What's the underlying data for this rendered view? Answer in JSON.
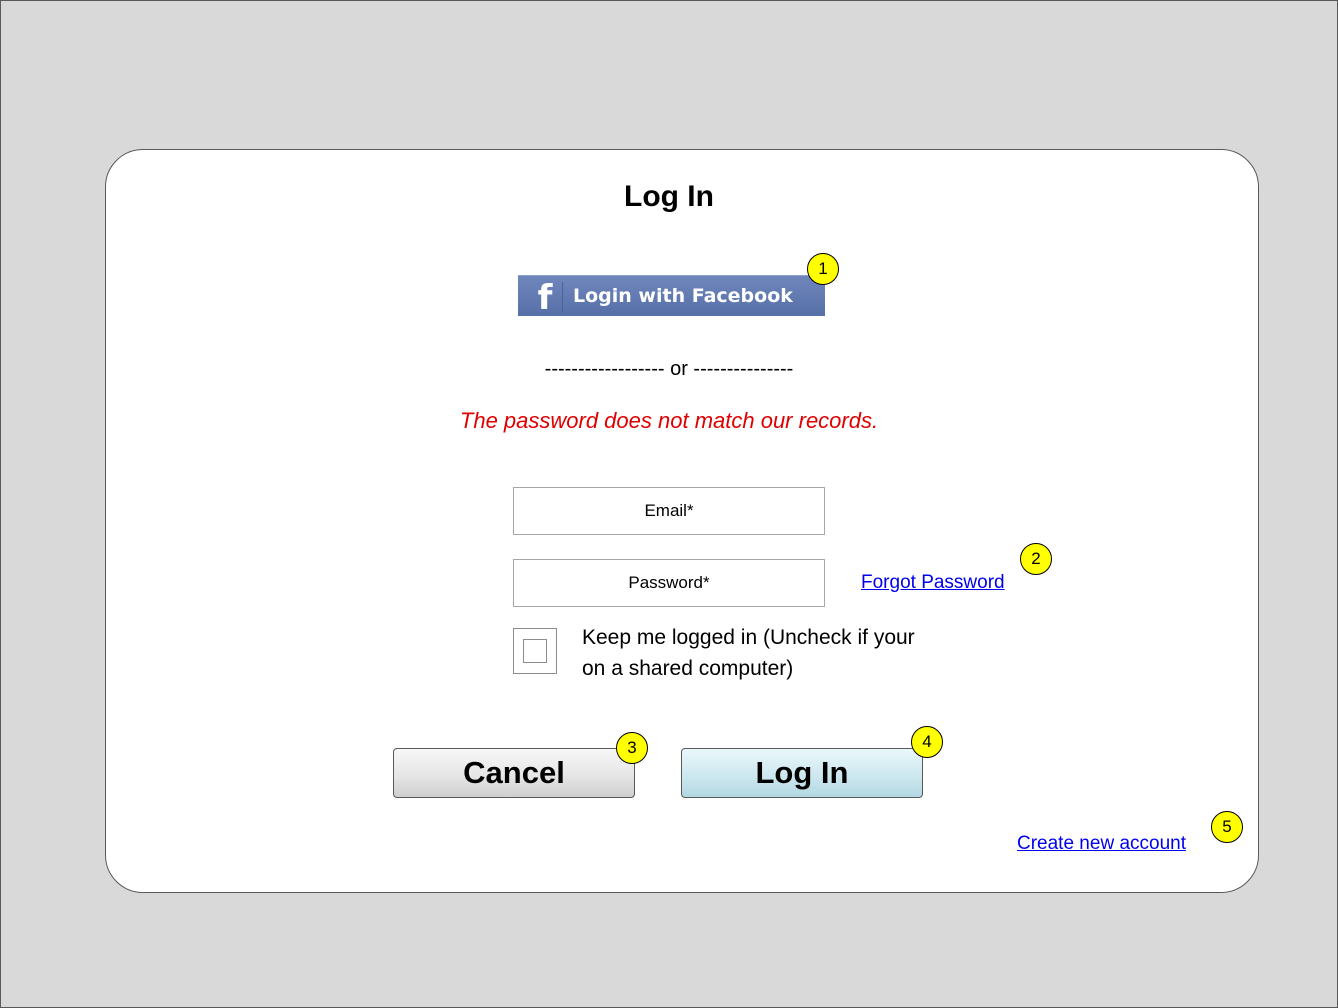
{
  "dialog": {
    "title": "Log In",
    "facebook_button": {
      "label": "Login with Facebook",
      "icon": "facebook-f-icon"
    },
    "divider_text": "------------------ or ---------------",
    "error_message": "The password does not match our records.",
    "email_field": {
      "placeholder": "Email*",
      "value": ""
    },
    "password_field": {
      "placeholder": "Password*",
      "value": ""
    },
    "forgot_password_link": "Forgot Password",
    "keep_logged_in": {
      "label": "Keep me logged in (Uncheck if your on a shared computer)",
      "checked": false
    },
    "cancel_button": "Cancel",
    "login_button": "Log In",
    "create_account_link": "Create new account"
  },
  "annotations": [
    "1",
    "2",
    "3",
    "4",
    "5"
  ],
  "colors": {
    "backdrop": "#d9d9d9",
    "error_text": "#e00000",
    "link": "#0000ee",
    "annotation_marker": "#ffff00",
    "facebook_blue": "#5f78af",
    "login_button_tint": "#cde8ef"
  }
}
